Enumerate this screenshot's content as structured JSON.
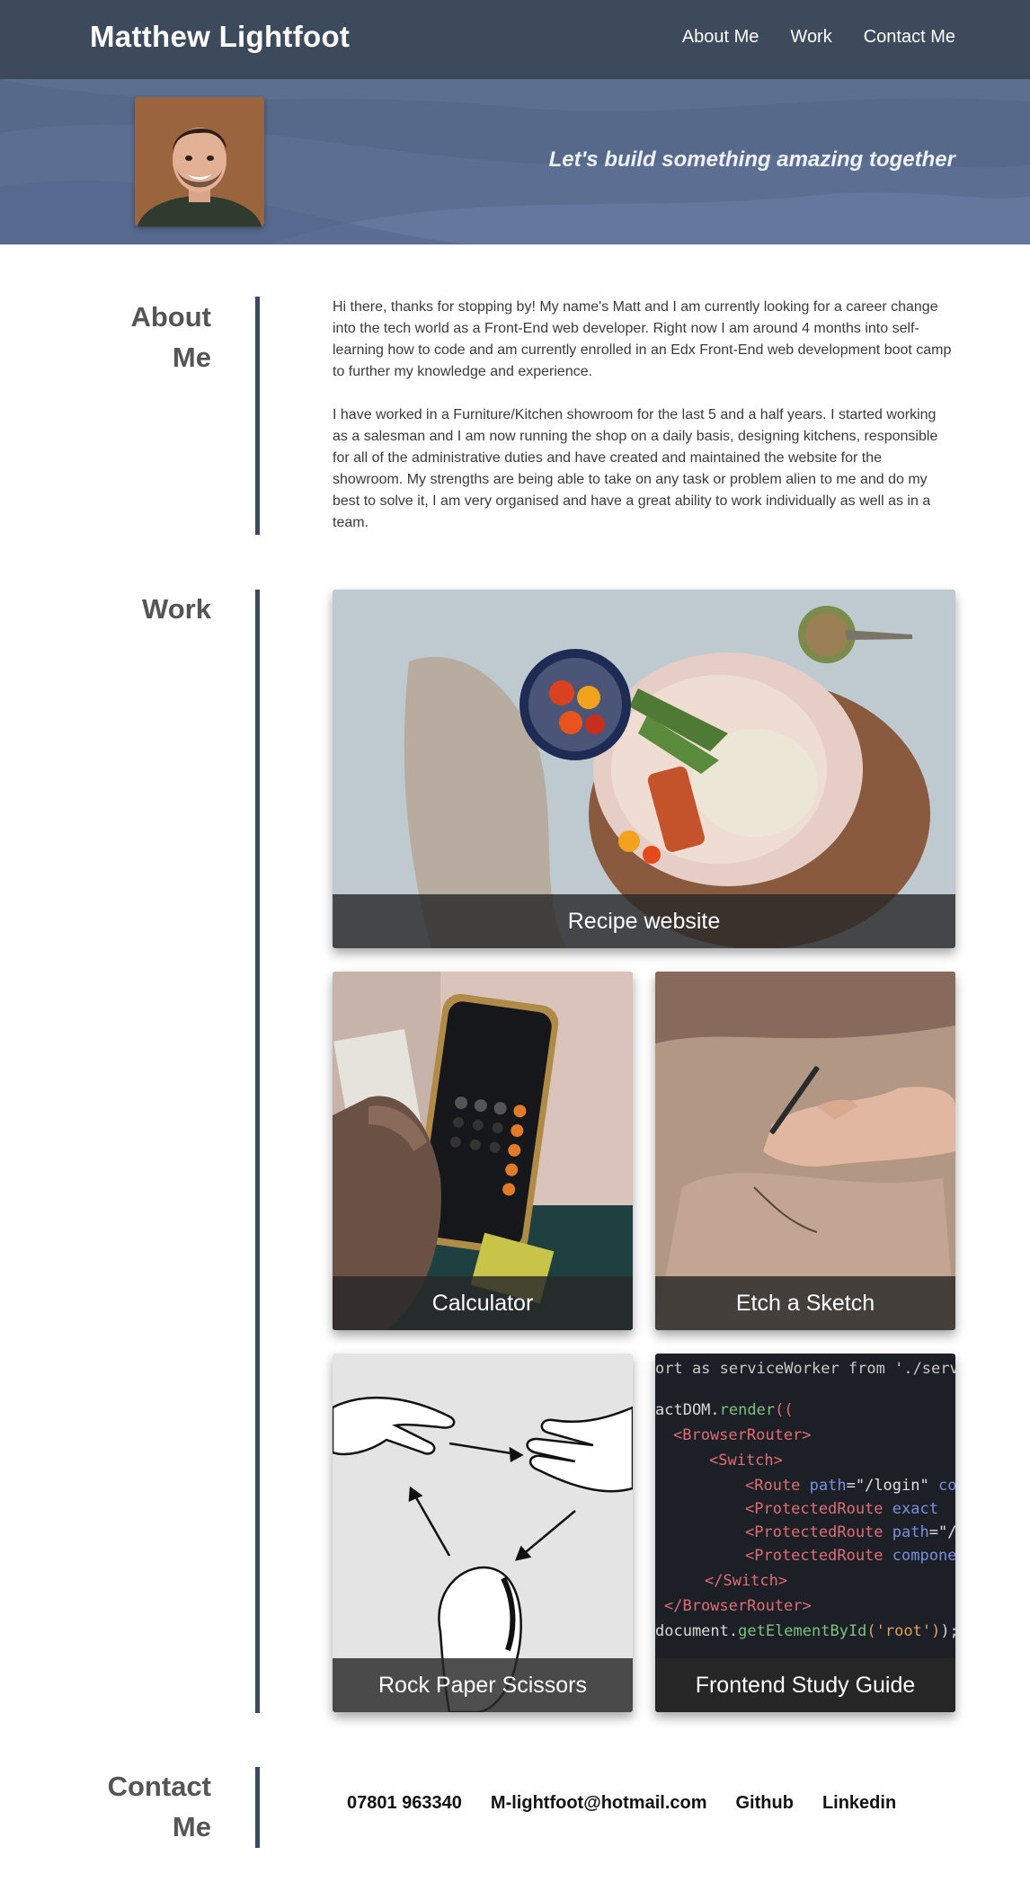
{
  "header": {
    "title": "Matthew Lightfoot",
    "nav": [
      {
        "label": "About Me"
      },
      {
        "label": "Work"
      },
      {
        "label": "Contact Me"
      }
    ]
  },
  "hero": {
    "tagline": "Let's build something amazing together",
    "avatar_icon": "profile-photo"
  },
  "about": {
    "title_line1": "About",
    "title_line2": "Me",
    "paragraphs": [
      "Hi there, thanks for stopping by! My name's Matt and I am currently looking for a career change into the tech world as a Front-End web developer. Right now I am around 4 months into self-learning how to code and am currently enrolled in an Edx Front-End web development boot camp to further my knowledge and experience.",
      "I have worked in a Furniture/Kitchen showroom for the last 5 and a half years. I started working as a salesman and I am now running the shop on a daily basis, designing kitchens, responsible for all of the administrative duties and have created and maintained the website for the showroom. My strengths are being able to take on any task or problem alien to me and do my best to solve it, I am very organised and have a great ability to work individually as well as in a team."
    ]
  },
  "work": {
    "title": "Work",
    "projects": [
      {
        "label": "Recipe website",
        "image": "food-plate-image"
      },
      {
        "label": "Calculator",
        "image": "phone-calculator-image"
      },
      {
        "label": "Etch a Sketch",
        "image": "hand-drawing-image"
      },
      {
        "label": "Rock Paper Scissors",
        "image": "hand-gestures-image"
      },
      {
        "label": "Frontend Study Guide",
        "image": "code-editor-image"
      }
    ]
  },
  "contact": {
    "title_line1": "Contact",
    "title_line2": "Me",
    "phone": "07801 963340",
    "email": "M-lightfoot@hotmail.com",
    "github": "Github",
    "linkedin": "Linkedin"
  },
  "colors": {
    "header_bg": "#3d4a5c",
    "hero_bg": "#56698a",
    "accent_line": "#3d4a5c"
  }
}
